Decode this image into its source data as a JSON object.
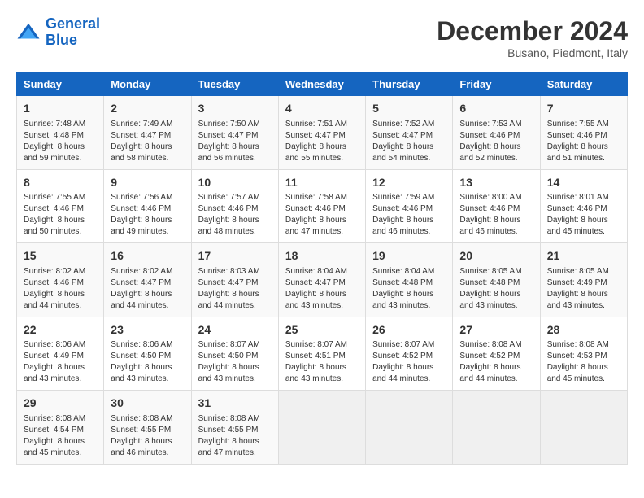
{
  "header": {
    "logo_line1": "General",
    "logo_line2": "Blue",
    "title": "December 2024",
    "subtitle": "Busano, Piedmont, Italy"
  },
  "calendar": {
    "columns": [
      "Sunday",
      "Monday",
      "Tuesday",
      "Wednesday",
      "Thursday",
      "Friday",
      "Saturday"
    ],
    "weeks": [
      [
        {
          "day": "1",
          "sunrise": "Sunrise: 7:48 AM",
          "sunset": "Sunset: 4:48 PM",
          "daylight": "Daylight: 8 hours and 59 minutes."
        },
        {
          "day": "2",
          "sunrise": "Sunrise: 7:49 AM",
          "sunset": "Sunset: 4:47 PM",
          "daylight": "Daylight: 8 hours and 58 minutes."
        },
        {
          "day": "3",
          "sunrise": "Sunrise: 7:50 AM",
          "sunset": "Sunset: 4:47 PM",
          "daylight": "Daylight: 8 hours and 56 minutes."
        },
        {
          "day": "4",
          "sunrise": "Sunrise: 7:51 AM",
          "sunset": "Sunset: 4:47 PM",
          "daylight": "Daylight: 8 hours and 55 minutes."
        },
        {
          "day": "5",
          "sunrise": "Sunrise: 7:52 AM",
          "sunset": "Sunset: 4:47 PM",
          "daylight": "Daylight: 8 hours and 54 minutes."
        },
        {
          "day": "6",
          "sunrise": "Sunrise: 7:53 AM",
          "sunset": "Sunset: 4:46 PM",
          "daylight": "Daylight: 8 hours and 52 minutes."
        },
        {
          "day": "7",
          "sunrise": "Sunrise: 7:55 AM",
          "sunset": "Sunset: 4:46 PM",
          "daylight": "Daylight: 8 hours and 51 minutes."
        }
      ],
      [
        {
          "day": "8",
          "sunrise": "Sunrise: 7:55 AM",
          "sunset": "Sunset: 4:46 PM",
          "daylight": "Daylight: 8 hours and 50 minutes."
        },
        {
          "day": "9",
          "sunrise": "Sunrise: 7:56 AM",
          "sunset": "Sunset: 4:46 PM",
          "daylight": "Daylight: 8 hours and 49 minutes."
        },
        {
          "day": "10",
          "sunrise": "Sunrise: 7:57 AM",
          "sunset": "Sunset: 4:46 PM",
          "daylight": "Daylight: 8 hours and 48 minutes."
        },
        {
          "day": "11",
          "sunrise": "Sunrise: 7:58 AM",
          "sunset": "Sunset: 4:46 PM",
          "daylight": "Daylight: 8 hours and 47 minutes."
        },
        {
          "day": "12",
          "sunrise": "Sunrise: 7:59 AM",
          "sunset": "Sunset: 4:46 PM",
          "daylight": "Daylight: 8 hours and 46 minutes."
        },
        {
          "day": "13",
          "sunrise": "Sunrise: 8:00 AM",
          "sunset": "Sunset: 4:46 PM",
          "daylight": "Daylight: 8 hours and 46 minutes."
        },
        {
          "day": "14",
          "sunrise": "Sunrise: 8:01 AM",
          "sunset": "Sunset: 4:46 PM",
          "daylight": "Daylight: 8 hours and 45 minutes."
        }
      ],
      [
        {
          "day": "15",
          "sunrise": "Sunrise: 8:02 AM",
          "sunset": "Sunset: 4:46 PM",
          "daylight": "Daylight: 8 hours and 44 minutes."
        },
        {
          "day": "16",
          "sunrise": "Sunrise: 8:02 AM",
          "sunset": "Sunset: 4:47 PM",
          "daylight": "Daylight: 8 hours and 44 minutes."
        },
        {
          "day": "17",
          "sunrise": "Sunrise: 8:03 AM",
          "sunset": "Sunset: 4:47 PM",
          "daylight": "Daylight: 8 hours and 44 minutes."
        },
        {
          "day": "18",
          "sunrise": "Sunrise: 8:04 AM",
          "sunset": "Sunset: 4:47 PM",
          "daylight": "Daylight: 8 hours and 43 minutes."
        },
        {
          "day": "19",
          "sunrise": "Sunrise: 8:04 AM",
          "sunset": "Sunset: 4:48 PM",
          "daylight": "Daylight: 8 hours and 43 minutes."
        },
        {
          "day": "20",
          "sunrise": "Sunrise: 8:05 AM",
          "sunset": "Sunset: 4:48 PM",
          "daylight": "Daylight: 8 hours and 43 minutes."
        },
        {
          "day": "21",
          "sunrise": "Sunrise: 8:05 AM",
          "sunset": "Sunset: 4:49 PM",
          "daylight": "Daylight: 8 hours and 43 minutes."
        }
      ],
      [
        {
          "day": "22",
          "sunrise": "Sunrise: 8:06 AM",
          "sunset": "Sunset: 4:49 PM",
          "daylight": "Daylight: 8 hours and 43 minutes."
        },
        {
          "day": "23",
          "sunrise": "Sunrise: 8:06 AM",
          "sunset": "Sunset: 4:50 PM",
          "daylight": "Daylight: 8 hours and 43 minutes."
        },
        {
          "day": "24",
          "sunrise": "Sunrise: 8:07 AM",
          "sunset": "Sunset: 4:50 PM",
          "daylight": "Daylight: 8 hours and 43 minutes."
        },
        {
          "day": "25",
          "sunrise": "Sunrise: 8:07 AM",
          "sunset": "Sunset: 4:51 PM",
          "daylight": "Daylight: 8 hours and 43 minutes."
        },
        {
          "day": "26",
          "sunrise": "Sunrise: 8:07 AM",
          "sunset": "Sunset: 4:52 PM",
          "daylight": "Daylight: 8 hours and 44 minutes."
        },
        {
          "day": "27",
          "sunrise": "Sunrise: 8:08 AM",
          "sunset": "Sunset: 4:52 PM",
          "daylight": "Daylight: 8 hours and 44 minutes."
        },
        {
          "day": "28",
          "sunrise": "Sunrise: 8:08 AM",
          "sunset": "Sunset: 4:53 PM",
          "daylight": "Daylight: 8 hours and 45 minutes."
        }
      ],
      [
        {
          "day": "29",
          "sunrise": "Sunrise: 8:08 AM",
          "sunset": "Sunset: 4:54 PM",
          "daylight": "Daylight: 8 hours and 45 minutes."
        },
        {
          "day": "30",
          "sunrise": "Sunrise: 8:08 AM",
          "sunset": "Sunset: 4:55 PM",
          "daylight": "Daylight: 8 hours and 46 minutes."
        },
        {
          "day": "31",
          "sunrise": "Sunrise: 8:08 AM",
          "sunset": "Sunset: 4:55 PM",
          "daylight": "Daylight: 8 hours and 47 minutes."
        },
        null,
        null,
        null,
        null
      ]
    ]
  }
}
